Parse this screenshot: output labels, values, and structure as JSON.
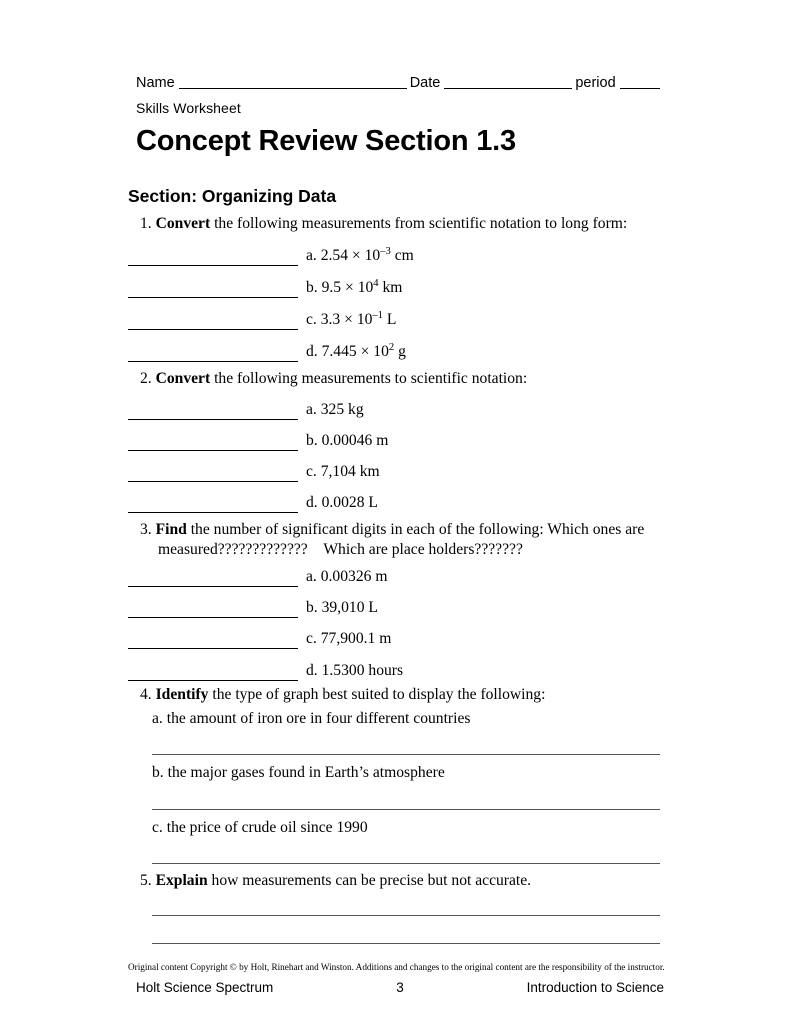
{
  "header": {
    "name_label": "Name",
    "date_label": "Date",
    "period_label": "period",
    "skills_worksheet": "Skills Worksheet",
    "title": "Concept Review Section 1.3"
  },
  "section": {
    "heading": "Section: Organizing Data"
  },
  "questions": [
    {
      "number": "1.",
      "action": "Convert",
      "stem": " the following measurements from scientific notation to long form:",
      "items": [
        {
          "label": "a.",
          "mantissa": "2.54 × 10",
          "exp": "–3",
          "unit": "cm"
        },
        {
          "label": "b.",
          "mantissa": "9.5 × 10",
          "exp": "4",
          "unit": "km"
        },
        {
          "label": "c.",
          "mantissa": "3.3 × 10",
          "exp": "–1",
          "unit": "L"
        },
        {
          "label": "d.",
          "mantissa": "7.445 × 10",
          "exp": "2",
          "unit": "g"
        }
      ]
    },
    {
      "number": "2.",
      "action": "Convert",
      "stem": " the following measurements to scientific notation:",
      "items": [
        {
          "label": "a.",
          "text": "325 kg"
        },
        {
          "label": "b.",
          "text": "0.00046 m"
        },
        {
          "label": "c.",
          "text": "7,104 km"
        },
        {
          "label": "d.",
          "text": "0.0028 L"
        }
      ]
    },
    {
      "number": "3.",
      "action": "Find",
      "stem": " the number of significant digits in each of the following: Which ones are",
      "stem_line2": "measured?????????????    Which are place holders???????",
      "items": [
        {
          "label": "a.",
          "text": "0.00326 m"
        },
        {
          "label": "b.",
          "text": "39,010 L"
        },
        {
          "label": "c.",
          "text": "77,900.1 m"
        },
        {
          "label": "d.",
          "text": "1.5300 hours"
        }
      ]
    },
    {
      "number": "4.",
      "action": "Identify",
      "stem": " the type of graph best suited to display the following:",
      "items": [
        {
          "label": "a.",
          "text": "the amount of iron ore in four different countries"
        },
        {
          "label": "b.",
          "text": "the major gases found in Earth’s atmosphere"
        },
        {
          "label": "c.",
          "text": "the price of crude oil since 1990"
        }
      ]
    },
    {
      "number": "5.",
      "action": "Explain",
      "stem": " how measurements can be precise but not accurate."
    }
  ],
  "footer": {
    "copyright": "Original content Copyright © by Holt, Rinehart and Winston. Additions and changes to the original content are the responsibility of the instructor.",
    "book": "Holt Science Spectrum",
    "page_number": "3",
    "chapter": "Introduction to Science"
  }
}
